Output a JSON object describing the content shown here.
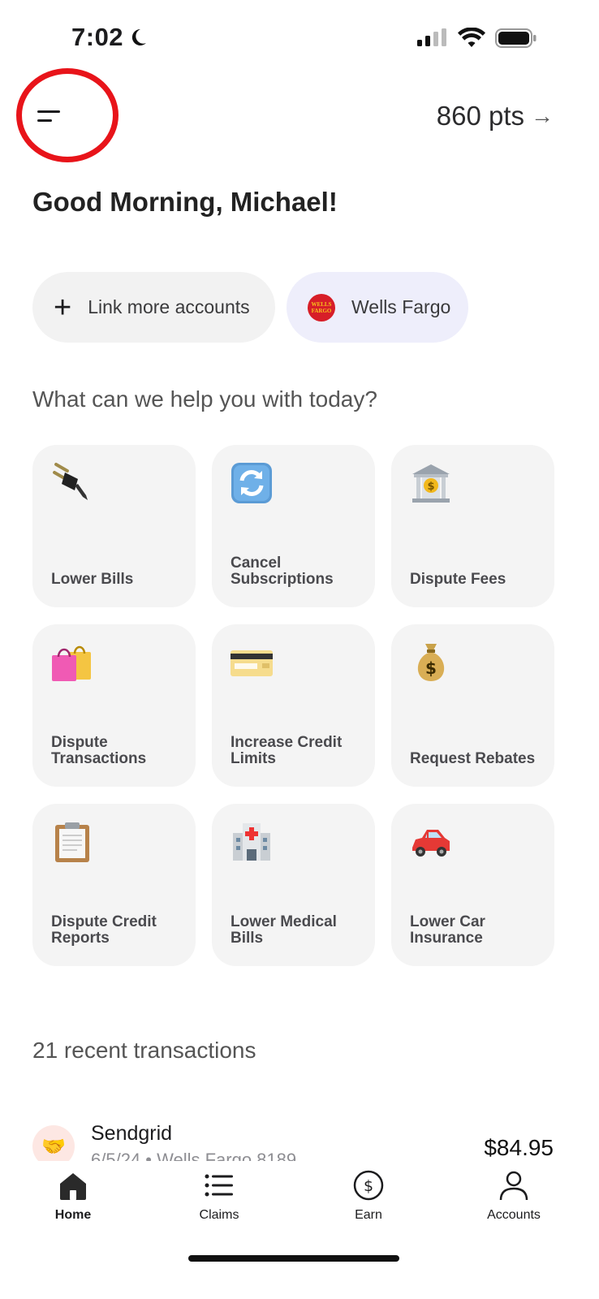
{
  "status_bar": {
    "time": "7:02"
  },
  "header": {
    "points": "860 pts",
    "points_arrow": "→"
  },
  "greeting": "Good Morning, Michael!",
  "accounts": {
    "link_label": "Link more accounts",
    "bank_label": "Wells Fargo",
    "bank_logo_text": "WELLS FARGO"
  },
  "help_title": "What can we help you with today?",
  "services": [
    {
      "label": "Lower Bills",
      "icon": "plug-icon"
    },
    {
      "label": "Cancel Subscriptions",
      "icon": "repeat-arrows-icon"
    },
    {
      "label": "Dispute Fees",
      "icon": "bank-icon"
    },
    {
      "label": "Dispute Transactions",
      "icon": "shopping-bags-icon"
    },
    {
      "label": "Increase Credit Limits",
      "icon": "credit-card-icon"
    },
    {
      "label": "Request Rebates",
      "icon": "money-bag-icon"
    },
    {
      "label": "Dispute Credit Reports",
      "icon": "clipboard-icon"
    },
    {
      "label": "Lower Medical Bills",
      "icon": "hospital-icon"
    },
    {
      "label": "Lower Car Insurance",
      "icon": "car-icon"
    }
  ],
  "recent": {
    "title": "21 recent transactions",
    "items": [
      {
        "name": "Sendgrid",
        "sub": "6/5/24 • Wells Fargo 8189",
        "amount": "$84.95",
        "icon": "handshake-icon"
      }
    ]
  },
  "tabs": [
    {
      "label": "Home",
      "icon": "home-icon",
      "active": true
    },
    {
      "label": "Claims",
      "icon": "list-icon",
      "active": false
    },
    {
      "label": "Earn",
      "icon": "dollar-circle-icon",
      "active": false
    },
    {
      "label": "Accounts",
      "icon": "person-icon",
      "active": false
    }
  ],
  "colors": {
    "highlight_circle": "#e8141a",
    "tile_bg": "#f4f4f4",
    "chip_bg": "#f2f2f2",
    "bank_chip_bg": "#eeeefb",
    "wells_fargo_red": "#d71e28"
  }
}
